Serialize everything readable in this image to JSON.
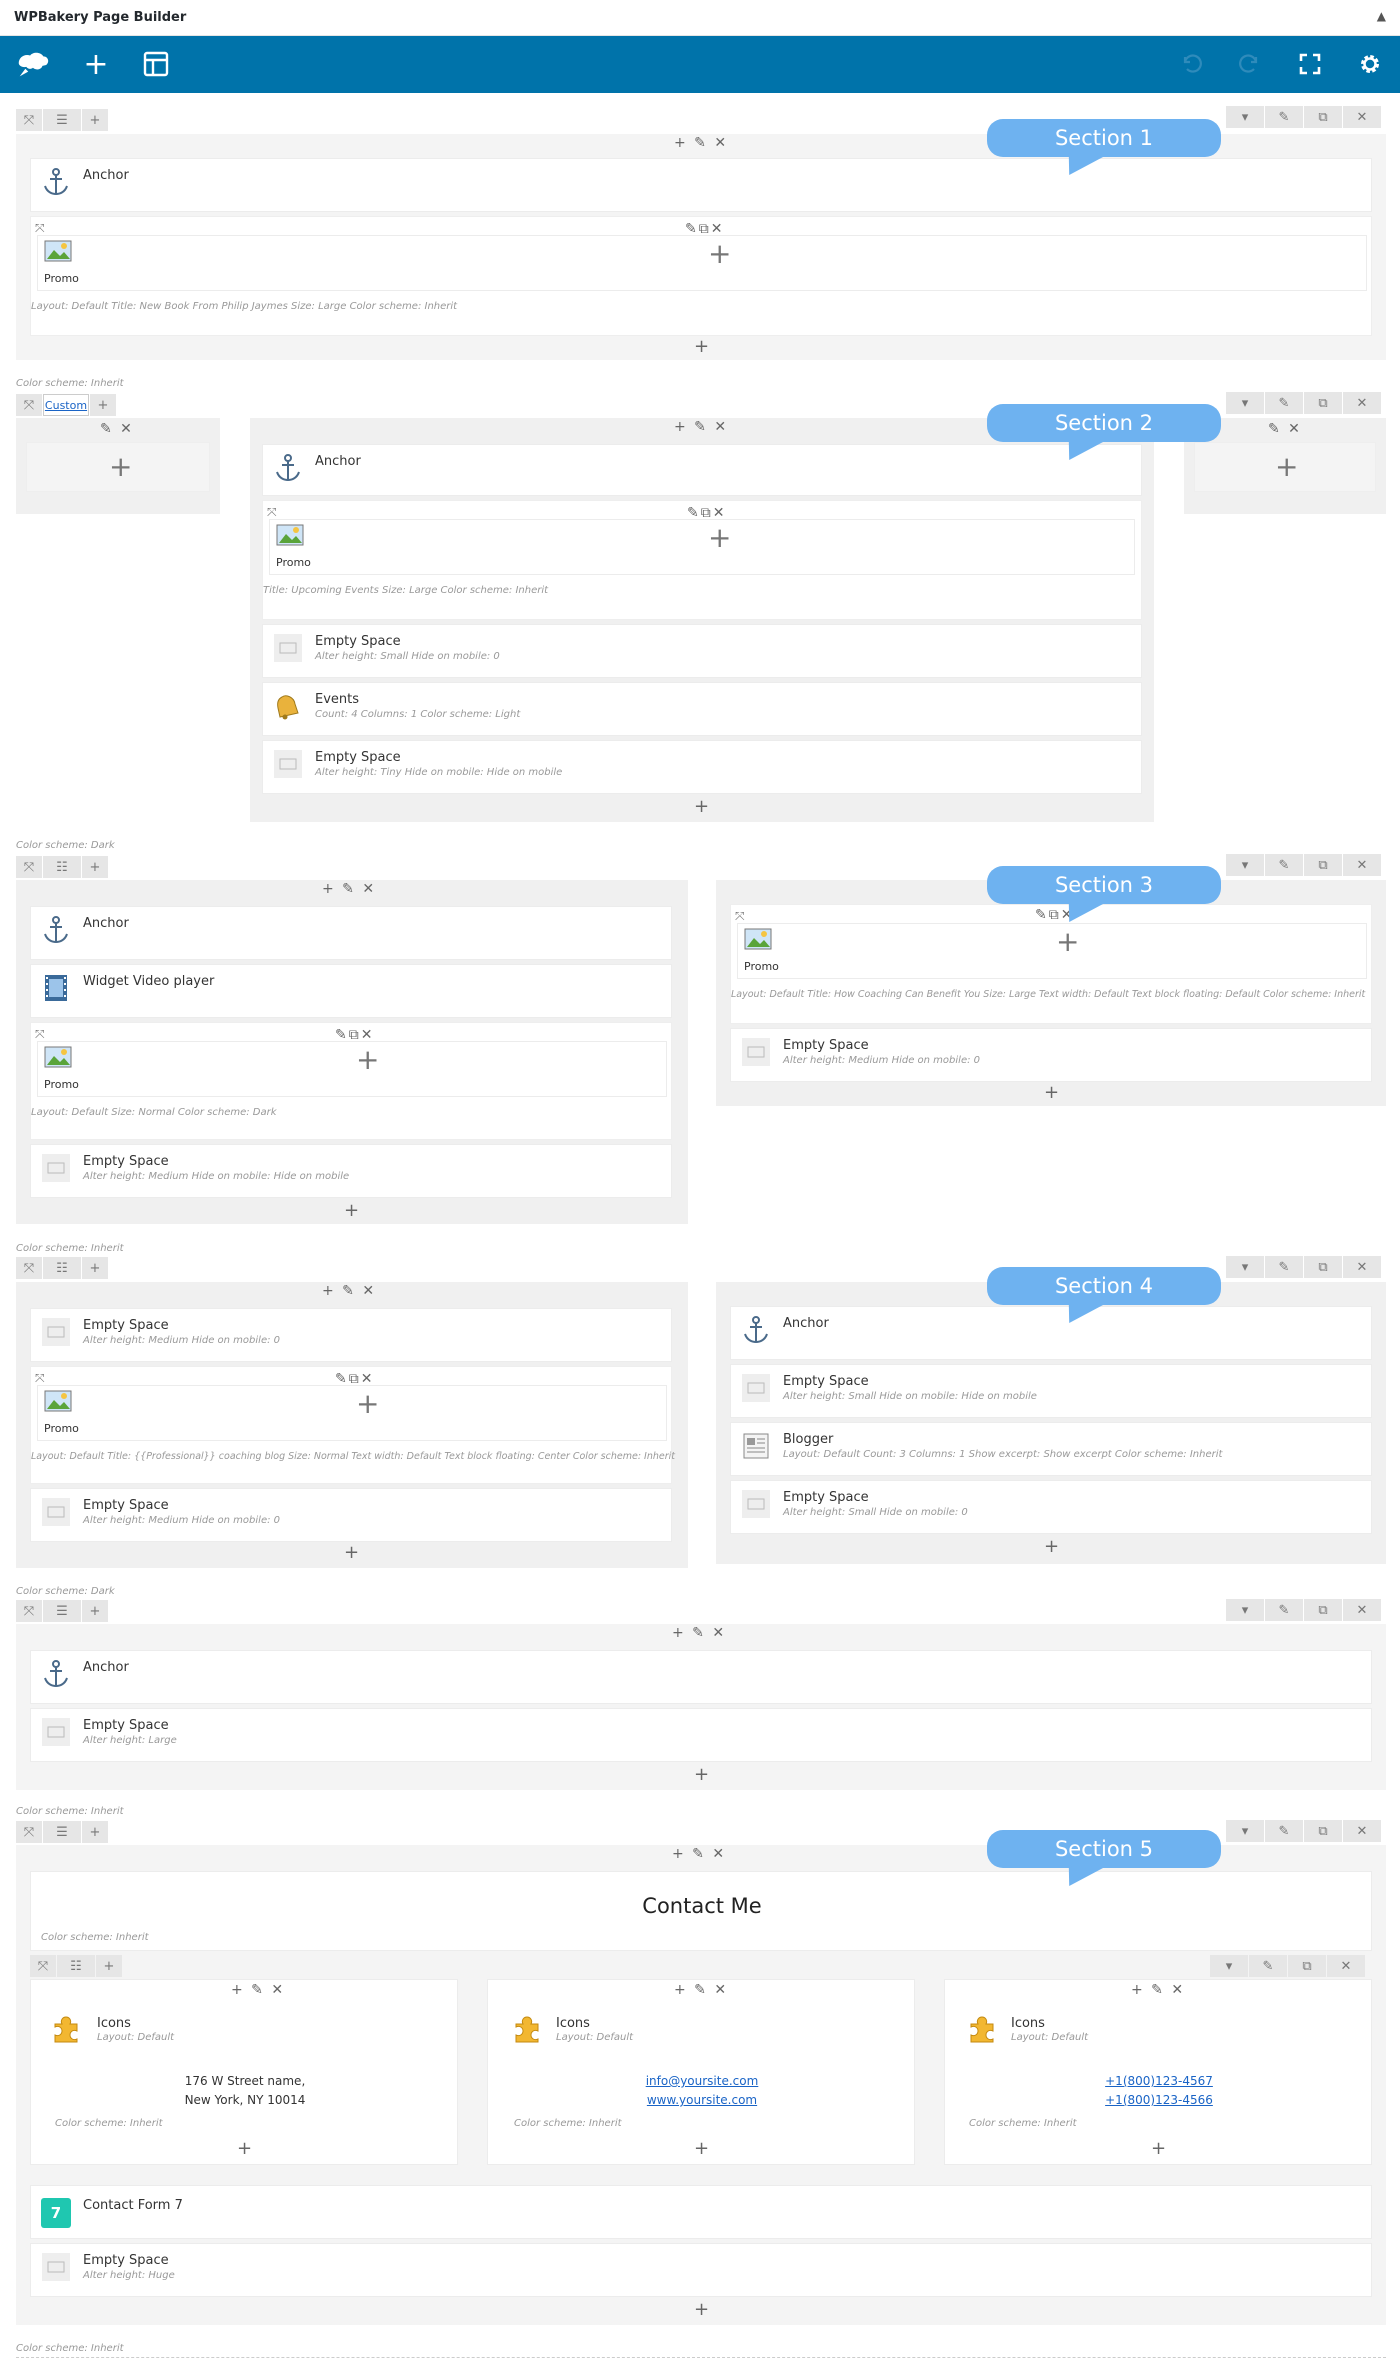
{
  "app": {
    "title": "WPBakery Page Builder"
  },
  "sections": {
    "s1": "Section 1",
    "s2": "Section 2",
    "s3": "Section 3",
    "s4": "Section 4",
    "s5": "Section 5"
  },
  "labels": {
    "anchor": "Anchor",
    "promo": "Promo",
    "empty_space": "Empty Space",
    "events": "Events",
    "video": "Widget Video player",
    "blogger": "Blogger",
    "icons": "Icons",
    "contact_form": "Contact Form 7",
    "contact_title": "Contact Me",
    "custom": "Custom"
  },
  "meta": {
    "r1_promo": "Layout: Default  Title: New Book From Philip Jaymes  Size: Large  Color scheme: Inherit",
    "cs_inherit": "Color scheme: Inherit",
    "cs_dark": "Color scheme: Dark",
    "r2_promo": "Title: Upcoming Events  Size: Large  Color scheme: Inherit",
    "r2_es1": "Alter height: Small  Hide on mobile: 0",
    "r2_events": "Count: 4  Columns: 1  Color scheme: Light",
    "r2_es2": "Alter height: Tiny  Hide on mobile: Hide on mobile",
    "r3l_promo": "Layout: Default  Size: Normal  Color scheme: Dark",
    "r3l_es": "Alter height: Medium  Hide on mobile: Hide on mobile",
    "r3r_promo": "Layout: Default  Title: How Coaching Can Benefit You  Size: Large  Text width: Default  Text block floating: Default  Color scheme: Inherit",
    "r3r_es": "Alter height: Medium  Hide on mobile: 0",
    "r4l_es1": "Alter height: Medium  Hide on mobile: 0",
    "r4l_promo": "Layout: Default  Title: {{Professional}} coaching blog  Size: Normal  Text width: Default  Text block floating: Center  Color scheme: Inherit",
    "r4l_es2": "Alter height: Medium  Hide on mobile: 0",
    "r4r_es1": "Alter height: Small  Hide on mobile: Hide on mobile",
    "r4r_blogger": "Layout: Default  Count: 3  Columns: 1  Show excerpt: Show excerpt  Color scheme: Inherit",
    "r4r_es2": "Alter height: Small  Hide on mobile: 0",
    "r5_es": "Alter height: Large",
    "icons_layout": "Layout: Default",
    "r6_es": "Alter height: Huge"
  },
  "contact": {
    "addr1": "176 W Street name,",
    "addr2": "New York, NY 10014",
    "email": "info@yoursite.com",
    "web": "www.yoursite.com",
    "phone1": "+1(800)123-4567",
    "phone2": "+1(800)123-4566"
  },
  "colors": {
    "accent": "#0073aa",
    "bubble": "#6eb2f0",
    "cf7": "#1fc7b0"
  }
}
